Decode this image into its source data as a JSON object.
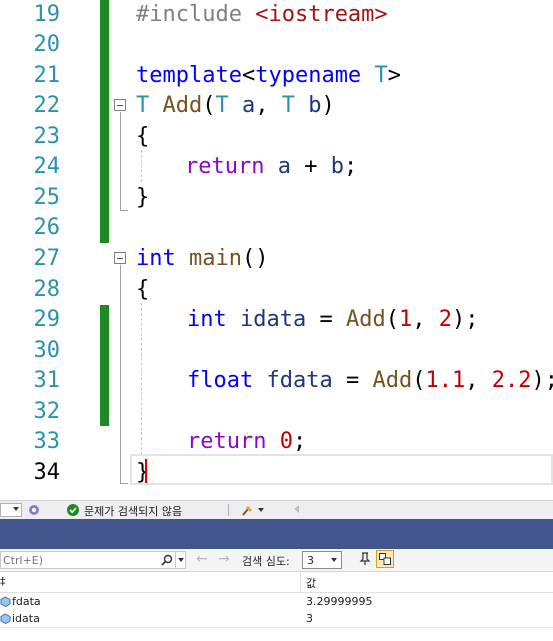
{
  "editor": {
    "line_numbers": [
      "19",
      "20",
      "21",
      "22",
      "23",
      "24",
      "25",
      "26",
      "27",
      "28",
      "29",
      "30",
      "31",
      "32",
      "33",
      "34"
    ],
    "line19": {
      "directive": "#include",
      "header": "<iostream>"
    },
    "line21": {
      "kw_template": "template",
      "lt": "<",
      "kw_typename": "typename",
      "tparam": "T",
      "gt": ">"
    },
    "line22": {
      "ret_type": "T",
      "fn_name": "Add",
      "open": "(",
      "type_a": "T",
      "param_a": "a",
      "comma": ",",
      "type_b": "T",
      "param_b": "b",
      "close": ")"
    },
    "line23": "{",
    "line24": {
      "kw_return": "return",
      "var_a": "a",
      "op": "+",
      "var_b": "b",
      "semi": ";"
    },
    "line25": "}",
    "line27": {
      "kw_int": "int",
      "fn_main": "main",
      "parens": "()"
    },
    "line28": "{",
    "line29": {
      "kw_int": "int",
      "var": "idata",
      "eq": "=",
      "fn": "Add",
      "open": "(",
      "n1": "1",
      "comma": ",",
      "n2": "2",
      "close": ");"
    },
    "line31": {
      "kw_float": "float",
      "var": "fdata",
      "eq": "=",
      "fn": "Add",
      "open": "(",
      "n1": "1.1",
      "comma": ",",
      "n2": "2.2",
      "close": ");"
    },
    "line33": {
      "kw_return": "return",
      "n": "0",
      "semi": ";"
    },
    "line34": "}"
  },
  "status": {
    "message": "문제가 검색되지 않음"
  },
  "locals": {
    "search_placeholder": "Ctrl+E)",
    "search_depth_label": "검색 심도:",
    "search_depth_value": "3",
    "columns": {
      "name": "‡",
      "value": "값"
    },
    "rows": [
      {
        "name": "fdata",
        "value": "3.29999995"
      },
      {
        "name": "idata",
        "value": "3"
      }
    ]
  },
  "colors": {
    "change_marker": "#1e8a24",
    "panel_header": "#40568d",
    "keyword": "#0000ff",
    "type": "#2b91af",
    "control_keyword": "#8f08c4",
    "function": "#74531f",
    "number": "#c00000",
    "string": "#a31515"
  }
}
